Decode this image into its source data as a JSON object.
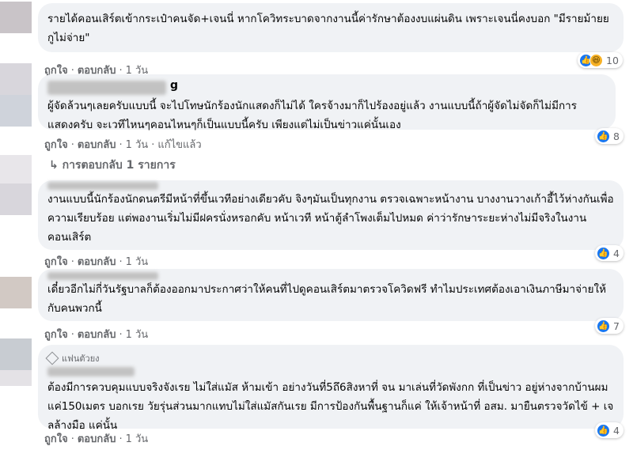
{
  "comments": [
    {
      "text": "รายได้คอนเสิร์ตเข้ากระเป๋าคนจัด+เจนนี่ หากโควิทระบาดจากงานนี้ค่ารักษาต้องงบแผ่นดิน เพราะเจนนี่คงบอก \"มีรายม้ายย กูไม่จ่าย\"",
      "like": "ถูกใจ",
      "reply": "ตอบกลับ",
      "time": "1 วัน",
      "count": "10"
    },
    {
      "name_tail": "g",
      "text": "ผู้จัดล้วนๆเลยครับแบบนี้ จะไปโทษนักร้องนักแสดงก็ไม่ได้ ใครจ้างมาก็ไปร้องอยู่แล้ว งานแบบนี้ถ้าผู้จัดไม่จัดก็ไม่มีการแสดงครับ จะเวทีไหนๆคอนไหนๆก็เป็นแบบนี้ครับ เพียงแต่ไม่เป็นข่าวแค่นั้นเอง",
      "like": "ถูกใจ",
      "reply": "ตอบกลับ",
      "time": "1 วัน",
      "edited": "แก้ไขแล้ว",
      "count": "8"
    },
    {
      "text": "งานแบบนี้นักร้องนักดนตรีมีหน้าที่ขึ้นเวทีอย่างเดียวคับ จิงๆมันเป็นทุกงาน ตรวจเฉพาะหน้างาน บางงานวางเก้าอี้ไว้ห่างกันเพื่อความเรียบร้อย แต่พองานเริ่มไม่มีฝครนั่งหรอกคับ หน้าเวที หน้าตู้ลำโพงเต็มไปหมด ค่าว่ารักษาระยะห่างไม่มีจริงในงานคอนเสิร์ต",
      "like": "ถูกใจ",
      "reply": "ตอบกลับ",
      "time": "1 วัน",
      "count": "4"
    },
    {
      "text": "เดี๋ยวอีกไม่กี่วันรัฐบาลก็ต้องออกมาประกาศว่าให้คนที่ไปดูคอนเสิร์ตมาตรวจโควิดฟรี ทำไมประเทศต้องเอาเงินภาษีมาจ่ายให้กับคนพวกนี้",
      "like": "ถูกใจ",
      "reply": "ตอบกลับ",
      "time": "1 วัน",
      "count": "7"
    },
    {
      "badge": "แฟนตัวยง",
      "text": "ต้องมีการควบคุมแบบจริงจังเรย ไม่ใส่แมัส ห้ามเข้า อย่างวันที่5ถึ6สิงหาที่ จน มาเล่นที่วัดพังกก ที่เป็นข่าว อยู่ห่างจากบ้านผมแค่150เมตร บอกเรย วัยรุ่นส่วนมากแทบไม่ใส่แมัสกันเรย มีการป้องกันพื้นฐานก็แค่ ให้เจ้าหน้าที่ อสม. มายืนตรวจวัดไข้ + เจลล้างมือ แค่นั้น",
      "like": "ถูกใจ",
      "reply": "ตอบกลับ",
      "time": "1 วัน",
      "count": "4"
    }
  ],
  "replies_label": "การตอบกลับ 1 รายการ",
  "colors": {
    "like": "#1877f2",
    "bubble": "#f0f2f5",
    "meta": "#65676b"
  },
  "icons": {
    "like": "like-icon",
    "haha": "haha-icon",
    "reply_arrow": "reply-arrow-icon",
    "fan": "diamond-icon"
  }
}
